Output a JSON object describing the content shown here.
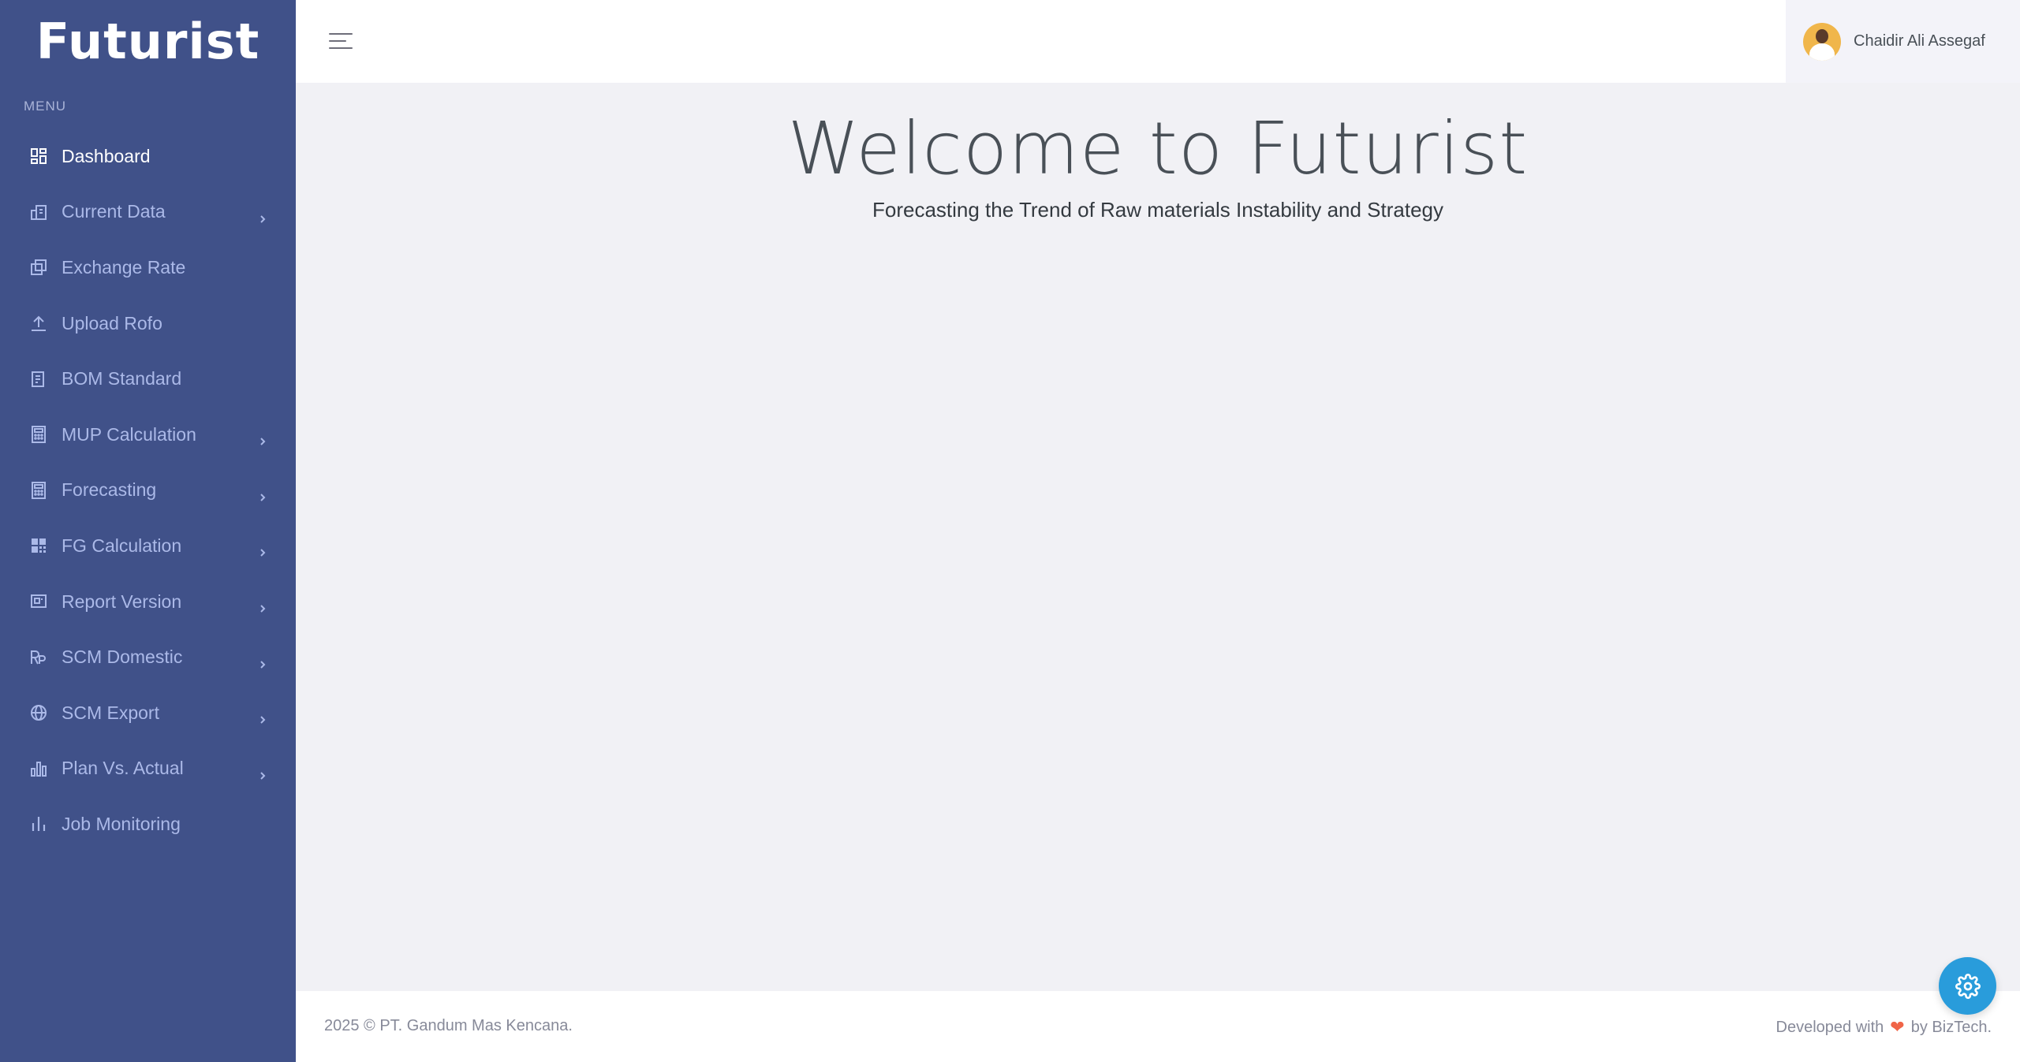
{
  "brand": {
    "name": "Futurist"
  },
  "sidebar": {
    "menu_title": "MENU",
    "items": [
      {
        "label": "Dashboard",
        "icon": "dashboard-icon",
        "has_submenu": false,
        "active": true
      },
      {
        "label": "Current Data",
        "icon": "building-chart-icon",
        "has_submenu": true
      },
      {
        "label": "Exchange Rate",
        "icon": "copy-icon",
        "has_submenu": false
      },
      {
        "label": "Upload Rofo",
        "icon": "upload-icon",
        "has_submenu": false
      },
      {
        "label": "BOM Standard",
        "icon": "document-list-icon",
        "has_submenu": false
      },
      {
        "label": "MUP Calculation",
        "icon": "calculator-icon",
        "has_submenu": true
      },
      {
        "label": "Forecasting",
        "icon": "calculator-icon",
        "has_submenu": true
      },
      {
        "label": "FG Calculation",
        "icon": "grid-icon",
        "has_submenu": true
      },
      {
        "label": "Report Version",
        "icon": "presentation-icon",
        "has_submenu": true
      },
      {
        "label": "SCM Domestic",
        "icon": "rupiah-icon",
        "has_submenu": true
      },
      {
        "label": "SCM Export",
        "icon": "globe-icon",
        "has_submenu": true
      },
      {
        "label": "Plan Vs. Actual",
        "icon": "bar-chart-icon",
        "has_submenu": true
      },
      {
        "label": "Job Monitoring",
        "icon": "bar-lines-icon",
        "has_submenu": false
      }
    ]
  },
  "topbar": {
    "user_name": "Chaidir Ali Assegaf"
  },
  "main": {
    "welcome": "Welcome to Futurist",
    "subtitle": "Forecasting the Trend of Raw materials Instability and Strategy"
  },
  "footer": {
    "copyright": "2025 © PT. Gandum Mas Kencana.",
    "developed_prefix": "Developed with",
    "developed_suffix": "by BizTech."
  },
  "colors": {
    "sidebar_bg": "#405189",
    "fab_bg": "#299cdb",
    "heart": "#f06548"
  }
}
